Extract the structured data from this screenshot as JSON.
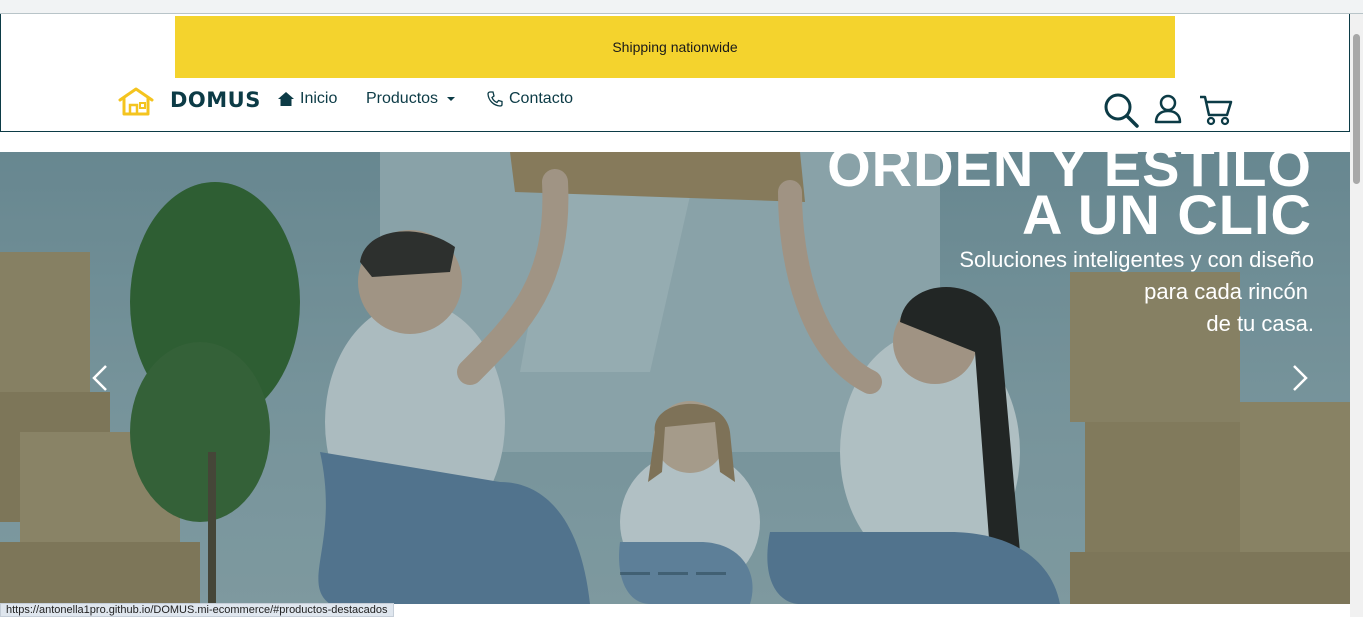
{
  "promo": {
    "text": "Shipping nationwide"
  },
  "brand": {
    "name": "DOMUS"
  },
  "nav": {
    "inicio": "Inicio",
    "productos": "Productos",
    "contacto": "Contacto"
  },
  "hero": {
    "headline_line1": "ORDEN Y ESTILO",
    "headline_line2": "A UN CLIC",
    "sub_line1": "Soluciones inteligentes y con diseño",
    "sub_line2": "para cada rincón",
    "sub_line3": "de tu casa."
  },
  "status": {
    "url": "https://antonella1pro.github.io/DOMUS.mi-ecommerce/#productos-destacados"
  },
  "colors": {
    "accent": "#f4d32d",
    "brand": "#0c3b46"
  }
}
